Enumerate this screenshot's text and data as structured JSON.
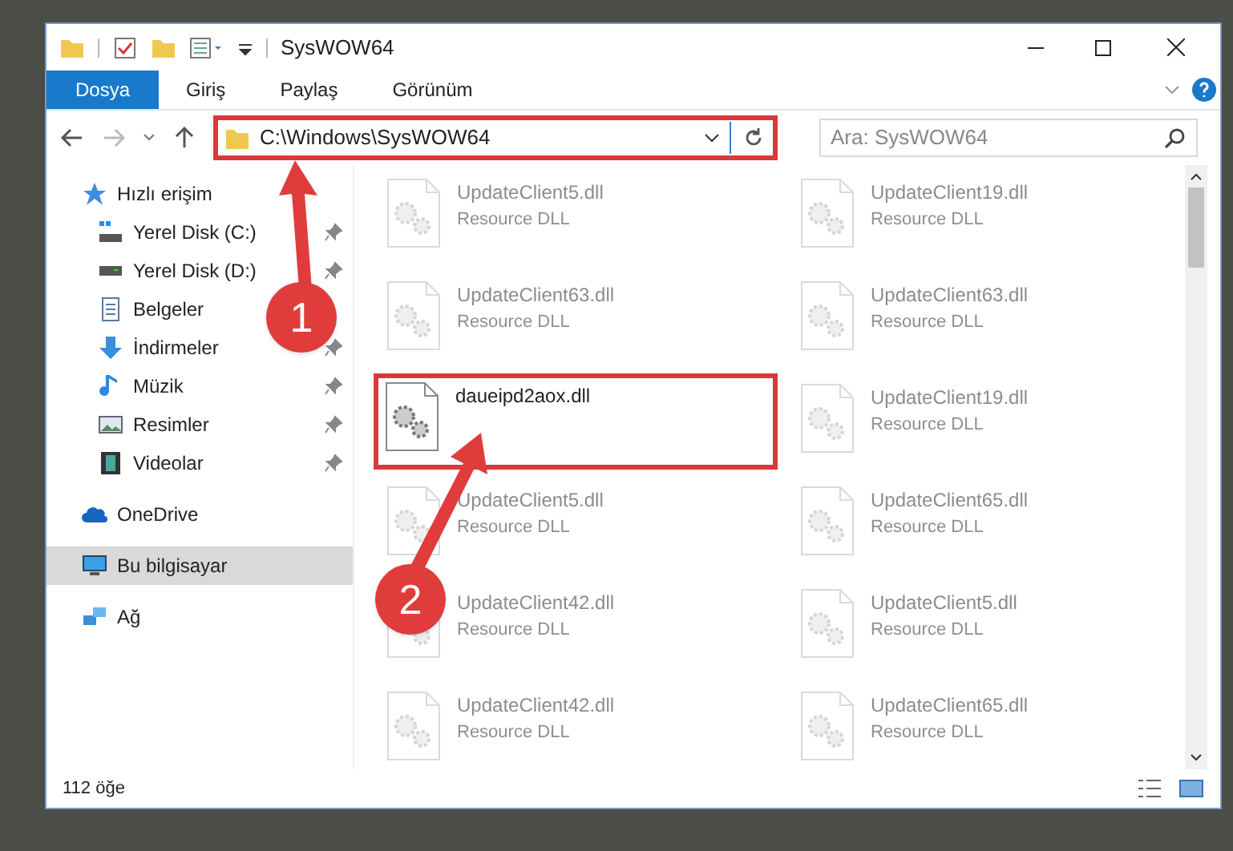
{
  "window": {
    "title": "SysWOW64"
  },
  "ribbon_tabs": [
    {
      "label": "Dosya",
      "selected": true
    },
    {
      "label": "Giriş",
      "selected": false
    },
    {
      "label": "Paylaş",
      "selected": false
    },
    {
      "label": "Görünüm",
      "selected": false
    }
  ],
  "address": {
    "path": "C:\\Windows\\SysWOW64",
    "highlighted": true
  },
  "search": {
    "placeholder": "Ara: SysWOW64"
  },
  "sidebar": {
    "items": [
      {
        "label": "Hızlı erişim",
        "kind": "star",
        "selected": false,
        "children": [
          {
            "label": "Yerel Disk (C:)",
            "kind": "disk-c",
            "pinned": true
          },
          {
            "label": "Yerel Disk (D:)",
            "kind": "disk",
            "pinned": true
          },
          {
            "label": "Belgeler",
            "kind": "doc"
          },
          {
            "label": "İndirmeler",
            "kind": "download",
            "pinned": true
          },
          {
            "label": "Müzik",
            "kind": "music",
            "pinned": true
          },
          {
            "label": "Resimler",
            "kind": "pictures",
            "pinned": true
          },
          {
            "label": "Videolar",
            "kind": "video",
            "pinned": true
          }
        ]
      },
      {
        "label": "OneDrive",
        "kind": "cloud",
        "selected": false
      },
      {
        "label": "Bu bilgisayar",
        "kind": "pc",
        "selected": true
      },
      {
        "label": "Ağ",
        "kind": "network",
        "selected": false
      }
    ]
  },
  "files": [
    {
      "name": "UpdateClient5.dll",
      "type": "Resource DLL",
      "dimmed": true,
      "highlighted": false
    },
    {
      "name": "UpdateClient19.dll",
      "type": "Resource DLL",
      "dimmed": true,
      "highlighted": false
    },
    {
      "name": "UpdateClient63.dll",
      "type": "Resource DLL",
      "dimmed": true,
      "highlighted": false
    },
    {
      "name": "UpdateClient63.dll",
      "type": "Resource DLL",
      "dimmed": true,
      "highlighted": false
    },
    {
      "name": "daueipd2aox.dll",
      "dimmed": false,
      "highlighted": true
    },
    {
      "name": "UpdateClient19.dll",
      "type": "Resource DLL",
      "dimmed": true,
      "highlighted": false
    },
    {
      "name": "UpdateClient5.dll",
      "type": "Resource DLL",
      "dimmed": true,
      "highlighted": false
    },
    {
      "name": "UpdateClient65.dll",
      "type": "Resource DLL",
      "dimmed": true,
      "highlighted": false
    },
    {
      "name": "UpdateClient42.dll",
      "type": "Resource DLL",
      "dimmed": true,
      "highlighted": false
    },
    {
      "name": "UpdateClient5.dll",
      "type": "Resource DLL",
      "dimmed": true,
      "highlighted": false
    },
    {
      "name": "UpdateClient42.dll",
      "type": "Resource DLL",
      "dimmed": true,
      "highlighted": false
    },
    {
      "name": "UpdateClient65.dll",
      "type": "Resource DLL",
      "dimmed": true,
      "highlighted": false
    }
  ],
  "status_bar": {
    "count": "112 öğe"
  },
  "annotations": [
    {
      "number": "1"
    },
    {
      "number": "2"
    }
  ]
}
